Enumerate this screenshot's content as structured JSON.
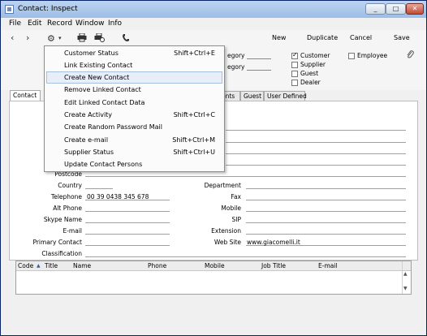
{
  "window": {
    "title": "Contact: Inspect"
  },
  "menubar": [
    "File",
    "Edit",
    "Record",
    "Window",
    "Info"
  ],
  "toolbar": {
    "new": "New",
    "duplicate": "Duplicate",
    "cancel": "Cancel",
    "save": "Save"
  },
  "header": {
    "category_label_1": "egory",
    "category_label_2": "egory",
    "checks": [
      {
        "label": "Customer",
        "checked": true
      },
      {
        "label": "Supplier",
        "checked": false
      },
      {
        "label": "Guest",
        "checked": false
      },
      {
        "label": "Dealer",
        "checked": false
      }
    ],
    "employee_label": "Employee"
  },
  "tabs": [
    {
      "label": "Contact"
    },
    {
      "label": "ents"
    },
    {
      "label": "Guest"
    },
    {
      "label": "User Defined"
    }
  ],
  "form": {
    "postcode": "Postcode",
    "country": "Country",
    "telephone": "Telephone",
    "telephone_value": "00 39 0438 345 678",
    "alt_phone": "Alt Phone",
    "skype": "Skype Name",
    "email": "E-mail",
    "primary_contact": "Primary Contact",
    "classification": "Classification",
    "department": "Department",
    "fax": "Fax",
    "mobile": "Mobile",
    "sip": "SIP",
    "extension": "Extension",
    "website": "Web Site",
    "website_value": "www.giacomelli.it"
  },
  "grid": {
    "sort_arrow": "▲",
    "columns": [
      "Code",
      "Title",
      "Name",
      "Phone",
      "Mobile",
      "Job Title",
      "E-mail"
    ]
  },
  "menu": [
    {
      "label": "Customer Status",
      "shortcut": "Shift+Ctrl+E"
    },
    {
      "label": "Link Existing Contact",
      "shortcut": ""
    },
    {
      "label": "Create New Contact",
      "shortcut": "",
      "highlighted": true
    },
    {
      "label": "Remove Linked Contact",
      "shortcut": ""
    },
    {
      "label": "Edit Linked Contact Data",
      "shortcut": ""
    },
    {
      "label": "Create Activity",
      "shortcut": "Shift+Ctrl+C"
    },
    {
      "label": "Create Random Password Mail",
      "shortcut": ""
    },
    {
      "label": "Create e-mail",
      "shortcut": "Shift+Ctrl+M"
    },
    {
      "label": "Supplier Status",
      "shortcut": "Shift+Ctrl+U"
    },
    {
      "label": "Update Contact Persons",
      "shortcut": ""
    }
  ]
}
